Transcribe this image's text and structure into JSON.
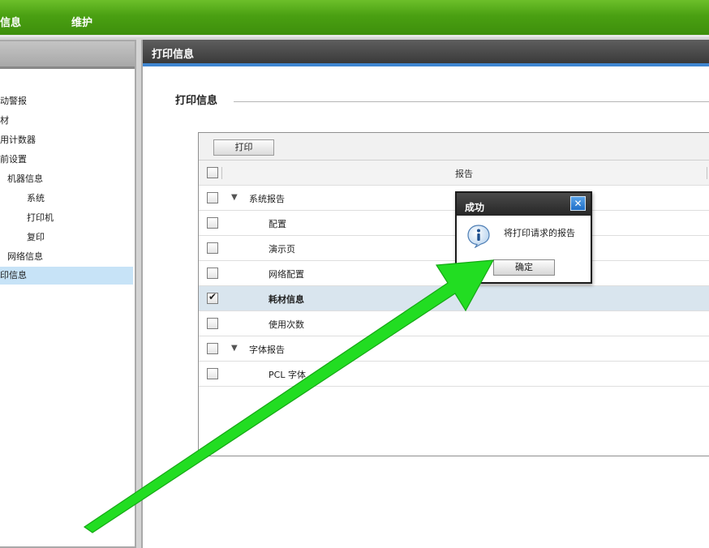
{
  "topnav": {
    "items": [
      "信息",
      "维护"
    ]
  },
  "sidebar": {
    "items": [
      {
        "label": "动警报"
      },
      {
        "label": "材"
      },
      {
        "label": "用计数器"
      },
      {
        "label": "前设置"
      },
      {
        "label": "机器信息"
      },
      {
        "label": "系统"
      },
      {
        "label": "打印机"
      },
      {
        "label": "复印"
      },
      {
        "label": "网络信息"
      },
      {
        "label": "印信息",
        "active": true
      }
    ]
  },
  "main": {
    "header_title": "打印信息",
    "section_title": "打印信息",
    "print_button": "打印",
    "table": {
      "column_header": "报告",
      "rows": [
        {
          "label": "系统报告",
          "group": true,
          "checked": false
        },
        {
          "label": "配置",
          "group": false,
          "checked": false
        },
        {
          "label": "演示页",
          "group": false,
          "checked": false
        },
        {
          "label": "网络配置",
          "group": false,
          "checked": false
        },
        {
          "label": "耗材信息",
          "group": false,
          "checked": true
        },
        {
          "label": "使用次数",
          "group": false,
          "checked": false
        },
        {
          "label": "字体报告",
          "group": true,
          "checked": false
        },
        {
          "label": "PCL 字体",
          "group": false,
          "checked": false
        }
      ]
    }
  },
  "dialog": {
    "title": "成功",
    "close_glyph": "✕",
    "message": "将打印请求的报告",
    "ok_label": "确定"
  },
  "colors": {
    "nav_green": "#4aa012",
    "arrow_green": "#22dd22",
    "selected_row": "#d9e5ee",
    "active_sidebar": "#c7e3f7"
  }
}
